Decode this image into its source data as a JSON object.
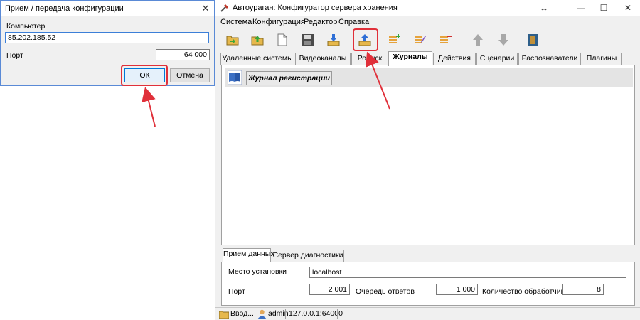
{
  "dialog": {
    "title": "Прием / передача конфигурации",
    "computer_label": "Компьютер",
    "computer_value": "85.202.185.52",
    "port_label": "Порт",
    "port_value": "64 000",
    "ok_label": "ОК",
    "cancel_label": "Отмена",
    "close_glyph": "✕"
  },
  "window": {
    "title": "Автоураган: Конфигуратор сервера хранения",
    "controls": {
      "resize": "↔",
      "minimize": "—",
      "maximize": "☐",
      "close": "✕"
    }
  },
  "menu": [
    "Система",
    "Конфигурация",
    "Редактор",
    "Справка"
  ],
  "toolbar_icons": [
    "open-folder-icon",
    "folder-up-icon",
    "new-document-icon",
    "save-disk-icon",
    "tray-download-icon",
    "tray-upload-icon",
    "list-add-icon",
    "list-edit-icon",
    "list-remove-icon",
    "arrow-up-icon",
    "arrow-down-icon",
    "book-icon"
  ],
  "tabs": [
    "Удаленные системы",
    "Видеоканалы",
    "Розыск",
    "Журналы",
    "Действия",
    "Сценарии",
    "Распознаватели",
    "Плагины"
  ],
  "active_tab": "Журналы",
  "log_panel": {
    "header": "Журнал регистрации"
  },
  "bottom_tabs": [
    "Прием данных",
    "Сервер диагностики"
  ],
  "bottom": {
    "location_label": "Место установки",
    "location_value": "localhost",
    "port_label": "Порт",
    "port_value": "2 001",
    "queue_label": "Очередь ответов",
    "queue_value": "1 000",
    "handlers_label": "Количество обработчиков",
    "handlers_value": "8"
  },
  "status": {
    "input": "Ввод...",
    "user": "admin",
    "address": "127.0.0.1:64000"
  },
  "colors": {
    "highlight": "#e0303a",
    "window_bg": "#f0f0f0"
  }
}
